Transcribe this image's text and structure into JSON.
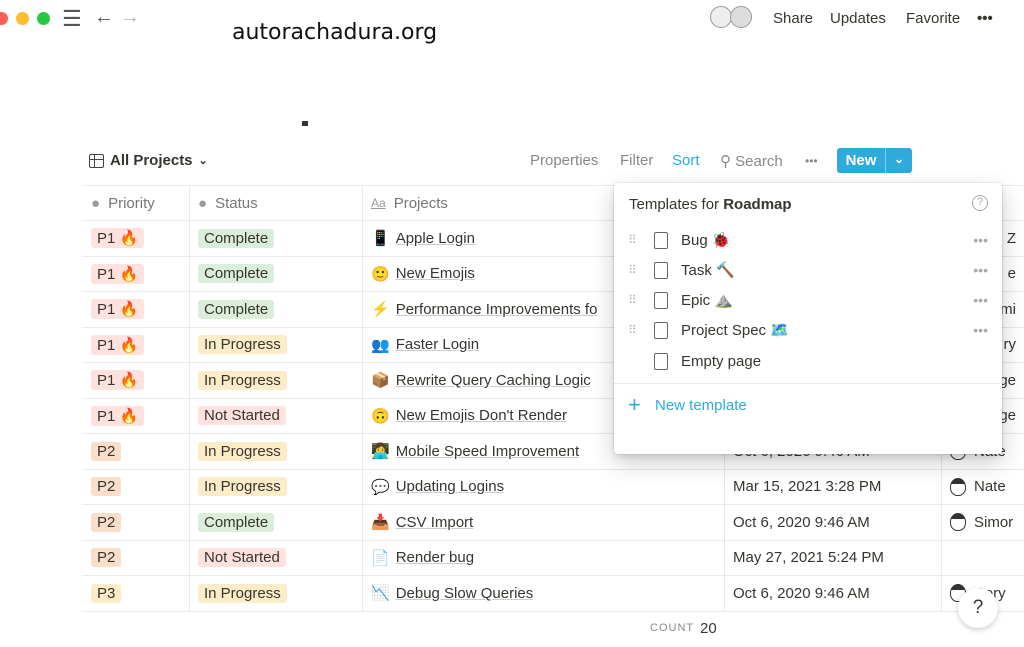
{
  "window": {
    "watermark": "autorachadura.org"
  },
  "topbar": {
    "share": "Share",
    "updates": "Updates",
    "favorite": "Favorite",
    "more": "•••"
  },
  "toolbar": {
    "view": "All Projects",
    "properties": "Properties",
    "filter": "Filter",
    "sort": "Sort",
    "search": "Search",
    "more": "•••",
    "new": "New"
  },
  "table": {
    "headers": [
      "Priority",
      "Status",
      "Projects"
    ],
    "rows": [
      {
        "p": "P1 🔥",
        "s": "Complete",
        "e": "📱",
        "n": "Apple Login",
        "d": "",
        "who": "n Z"
      },
      {
        "p": "P1 🔥",
        "s": "Complete",
        "e": "🙂",
        "n": "New Emojis",
        "d": "",
        "who": "e"
      },
      {
        "p": "P1 🔥",
        "s": "Complete",
        "e": "⚡",
        "n": "Performance Improvements fo",
        "d": "",
        "who": "mi"
      },
      {
        "p": "P1 🔥",
        "s": "In Progress",
        "e": "👥",
        "n": "Faster Login",
        "d": "",
        "who": "ry"
      },
      {
        "p": "P1 🔥",
        "s": "In Progress",
        "e": "📦",
        "n": "Rewrite Query Caching Logic",
        "d": "",
        "who": "ge"
      },
      {
        "p": "P1 🔥",
        "s": "Not Started",
        "e": "🙃",
        "n": "New Emojis Don't Render",
        "d": "",
        "who": "ge"
      },
      {
        "p": "P2",
        "s": "In Progress",
        "e": "👩‍💻",
        "n": "Mobile Speed Improvement",
        "d": "Oct 6, 2020 9:46 AM",
        "who": "Nate"
      },
      {
        "p": "P2",
        "s": "In Progress",
        "e": "💬",
        "n": "Updating Logins",
        "d": "Mar 15, 2021 3:28 PM",
        "who": "Nate"
      },
      {
        "p": "P2",
        "s": "Complete",
        "e": "📥",
        "n": "CSV Import",
        "d": "Oct 6, 2020 9:46 AM",
        "who": "Simor"
      },
      {
        "p": "P2",
        "s": "Not Started",
        "e": "📄",
        "n": "Render bug",
        "d": "May 27, 2021 5:24 PM",
        "who": ""
      },
      {
        "p": "P3",
        "s": "In Progress",
        "e": "📉",
        "n": "Debug Slow Queries",
        "d": "Oct 6, 2020 9:46 AM",
        "who": "Cory"
      }
    ]
  },
  "footer": {
    "count_label": "COUNT",
    "count": "20"
  },
  "templates": {
    "title_prefix": "Templates for ",
    "title_db": "Roadmap",
    "items": [
      "Bug 🐞",
      "Task 🔨",
      "Epic ⛰️",
      "Project Spec 🗺️"
    ],
    "empty": "Empty page",
    "new": "New template"
  },
  "help": "?",
  "colors": {
    "accent": "#2eaadc",
    "complete": "#dbeddb",
    "in_progress": "#fdecc8",
    "not_started": "#ffe2dd",
    "priority": "#ffe2dd"
  }
}
